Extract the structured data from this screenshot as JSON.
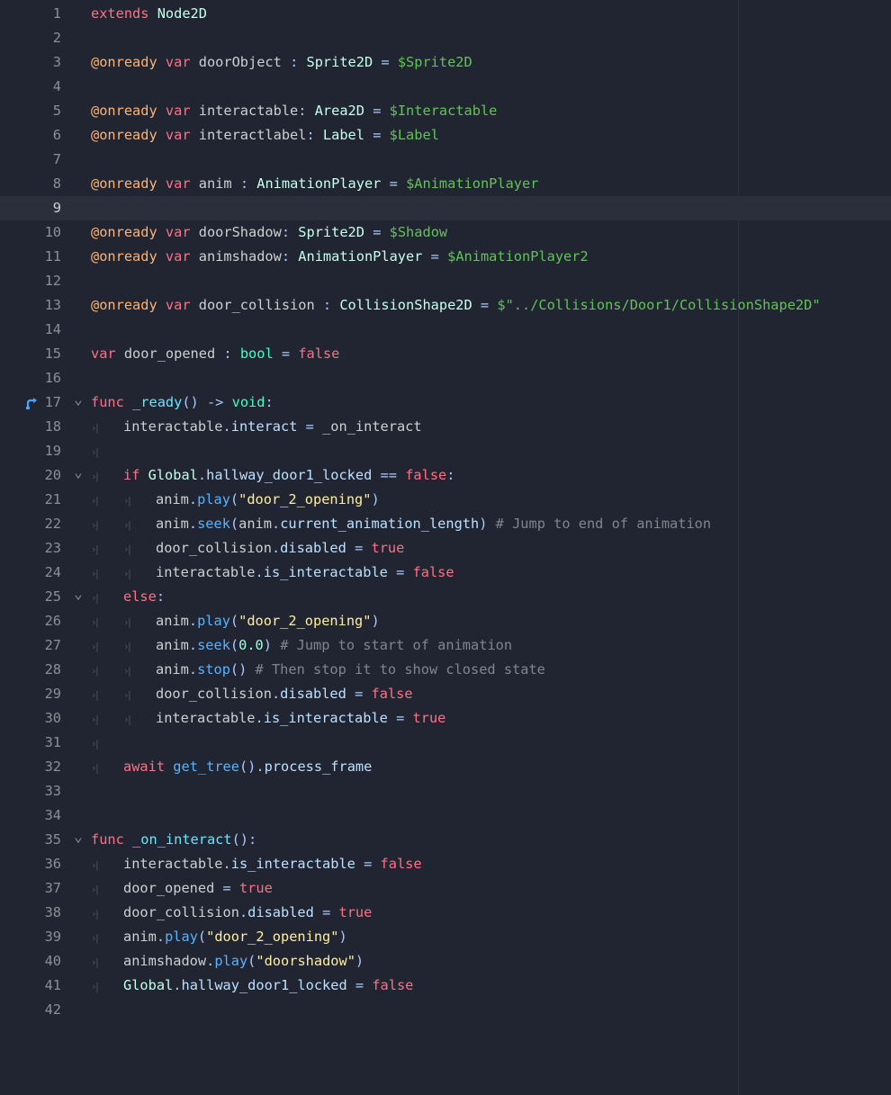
{
  "editor": {
    "current_line": 9,
    "lines": [
      {
        "n": "1",
        "fold": false,
        "indent": 0,
        "tokens": [
          {
            "t": "extends",
            "c": "k"
          },
          {
            "t": " "
          },
          {
            "t": "Node2D",
            "c": "tc"
          }
        ]
      },
      {
        "n": "2",
        "fold": false,
        "indent": 0,
        "tokens": []
      },
      {
        "n": "3",
        "fold": false,
        "indent": 0,
        "tokens": [
          {
            "t": "@onready",
            "c": "a"
          },
          {
            "t": " "
          },
          {
            "t": "var",
            "c": "k"
          },
          {
            "t": " doorObject "
          },
          {
            "t": ":",
            "c": "p"
          },
          {
            "t": " "
          },
          {
            "t": "Sprite2D",
            "c": "tc"
          },
          {
            "t": " "
          },
          {
            "t": "=",
            "c": "p"
          },
          {
            "t": " "
          },
          {
            "t": "$Sprite2D",
            "c": "np"
          }
        ]
      },
      {
        "n": "4",
        "fold": false,
        "indent": 0,
        "tokens": []
      },
      {
        "n": "5",
        "fold": false,
        "indent": 0,
        "tokens": [
          {
            "t": "@onready",
            "c": "a"
          },
          {
            "t": " "
          },
          {
            "t": "var",
            "c": "k"
          },
          {
            "t": " interactable"
          },
          {
            "t": ":",
            "c": "p"
          },
          {
            "t": " "
          },
          {
            "t": "Area2D",
            "c": "tc"
          },
          {
            "t": " "
          },
          {
            "t": "=",
            "c": "p"
          },
          {
            "t": " "
          },
          {
            "t": "$Interactable",
            "c": "np"
          }
        ]
      },
      {
        "n": "6",
        "fold": false,
        "indent": 0,
        "tokens": [
          {
            "t": "@onready",
            "c": "a"
          },
          {
            "t": " "
          },
          {
            "t": "var",
            "c": "k"
          },
          {
            "t": " interactlabel"
          },
          {
            "t": ":",
            "c": "p"
          },
          {
            "t": " "
          },
          {
            "t": "Label",
            "c": "tc"
          },
          {
            "t": " "
          },
          {
            "t": "=",
            "c": "p"
          },
          {
            "t": " "
          },
          {
            "t": "$Label",
            "c": "np"
          }
        ]
      },
      {
        "n": "7",
        "fold": false,
        "indent": 0,
        "tokens": []
      },
      {
        "n": "8",
        "fold": false,
        "indent": 0,
        "tokens": [
          {
            "t": "@onready",
            "c": "a"
          },
          {
            "t": " "
          },
          {
            "t": "var",
            "c": "k"
          },
          {
            "t": " anim "
          },
          {
            "t": ":",
            "c": "p"
          },
          {
            "t": " "
          },
          {
            "t": "AnimationPlayer",
            "c": "tc"
          },
          {
            "t": " "
          },
          {
            "t": "=",
            "c": "p"
          },
          {
            "t": " "
          },
          {
            "t": "$AnimationPlayer",
            "c": "np"
          }
        ]
      },
      {
        "n": "9",
        "fold": false,
        "indent": 0,
        "tokens": []
      },
      {
        "n": "10",
        "fold": false,
        "indent": 0,
        "tokens": [
          {
            "t": "@onready",
            "c": "a"
          },
          {
            "t": " "
          },
          {
            "t": "var",
            "c": "k"
          },
          {
            "t": " doorShadow"
          },
          {
            "t": ":",
            "c": "p"
          },
          {
            "t": " "
          },
          {
            "t": "Sprite2D",
            "c": "tc"
          },
          {
            "t": " "
          },
          {
            "t": "=",
            "c": "p"
          },
          {
            "t": " "
          },
          {
            "t": "$Shadow",
            "c": "np"
          }
        ]
      },
      {
        "n": "11",
        "fold": false,
        "indent": 0,
        "tokens": [
          {
            "t": "@onready",
            "c": "a"
          },
          {
            "t": " "
          },
          {
            "t": "var",
            "c": "k"
          },
          {
            "t": " animshadow"
          },
          {
            "t": ":",
            "c": "p"
          },
          {
            "t": " "
          },
          {
            "t": "AnimationPlayer",
            "c": "tc"
          },
          {
            "t": " "
          },
          {
            "t": "=",
            "c": "p"
          },
          {
            "t": " "
          },
          {
            "t": "$AnimationPlayer2",
            "c": "np"
          }
        ]
      },
      {
        "n": "12",
        "fold": false,
        "indent": 0,
        "tokens": []
      },
      {
        "n": "13",
        "fold": false,
        "indent": 0,
        "tokens": [
          {
            "t": "@onready",
            "c": "a"
          },
          {
            "t": " "
          },
          {
            "t": "var",
            "c": "k"
          },
          {
            "t": " door_collision "
          },
          {
            "t": ":",
            "c": "p"
          },
          {
            "t": " "
          },
          {
            "t": "CollisionShape2D",
            "c": "tc"
          },
          {
            "t": " "
          },
          {
            "t": "=",
            "c": "p"
          },
          {
            "t": " "
          },
          {
            "t": "$\"../Collisions/Door1/CollisionShape2D\"",
            "c": "np"
          }
        ]
      },
      {
        "n": "14",
        "fold": false,
        "indent": 0,
        "tokens": []
      },
      {
        "n": "15",
        "fold": false,
        "indent": 0,
        "tokens": [
          {
            "t": "var",
            "c": "k"
          },
          {
            "t": " door_opened "
          },
          {
            "t": ":",
            "c": "p"
          },
          {
            "t": " "
          },
          {
            "t": "bool",
            "c": "t"
          },
          {
            "t": " "
          },
          {
            "t": "=",
            "c": "p"
          },
          {
            "t": " "
          },
          {
            "t": "false",
            "c": "k"
          }
        ]
      },
      {
        "n": "16",
        "fold": false,
        "indent": 0,
        "tokens": []
      },
      {
        "n": "17",
        "fold": true,
        "override_icon": true,
        "indent": 0,
        "tokens": [
          {
            "t": "func",
            "c": "k"
          },
          {
            "t": " "
          },
          {
            "t": "_ready",
            "c": "fd"
          },
          {
            "t": "()",
            "c": "p"
          },
          {
            "t": " "
          },
          {
            "t": "->",
            "c": "p"
          },
          {
            "t": " "
          },
          {
            "t": "void",
            "c": "t"
          },
          {
            "t": ":",
            "c": "p"
          }
        ]
      },
      {
        "n": "18",
        "fold": false,
        "indent": 1,
        "tokens": [
          {
            "t": "interactable"
          },
          {
            "t": ".",
            "c": "p"
          },
          {
            "t": "interact",
            "c": "m"
          },
          {
            "t": " "
          },
          {
            "t": "=",
            "c": "p"
          },
          {
            "t": " _on_interact"
          }
        ]
      },
      {
        "n": "19",
        "fold": false,
        "indent": 1,
        "tokens": []
      },
      {
        "n": "20",
        "fold": true,
        "indent": 1,
        "tokens": [
          {
            "t": "if",
            "c": "k"
          },
          {
            "t": " "
          },
          {
            "t": "Global",
            "c": "tc"
          },
          {
            "t": ".",
            "c": "p"
          },
          {
            "t": "hallway_door1_locked",
            "c": "m"
          },
          {
            "t": " "
          },
          {
            "t": "==",
            "c": "p"
          },
          {
            "t": " "
          },
          {
            "t": "false",
            "c": "k"
          },
          {
            "t": ":",
            "c": "p"
          }
        ]
      },
      {
        "n": "21",
        "fold": false,
        "indent": 2,
        "tokens": [
          {
            "t": "anim"
          },
          {
            "t": ".",
            "c": "p"
          },
          {
            "t": "play",
            "c": "f"
          },
          {
            "t": "(",
            "c": "p"
          },
          {
            "t": "\"door_2_opening\"",
            "c": "s"
          },
          {
            "t": ")",
            "c": "p"
          }
        ]
      },
      {
        "n": "22",
        "fold": false,
        "indent": 2,
        "tokens": [
          {
            "t": "anim"
          },
          {
            "t": ".",
            "c": "p"
          },
          {
            "t": "seek",
            "c": "f"
          },
          {
            "t": "(",
            "c": "p"
          },
          {
            "t": "anim"
          },
          {
            "t": ".",
            "c": "p"
          },
          {
            "t": "current_animation_length",
            "c": "m"
          },
          {
            "t": ")",
            "c": "p"
          },
          {
            "t": " "
          },
          {
            "t": "# Jump to end of animation",
            "c": "c"
          }
        ]
      },
      {
        "n": "23",
        "fold": false,
        "indent": 2,
        "tokens": [
          {
            "t": "door_collision"
          },
          {
            "t": ".",
            "c": "p"
          },
          {
            "t": "disabled",
            "c": "m"
          },
          {
            "t": " "
          },
          {
            "t": "=",
            "c": "p"
          },
          {
            "t": " "
          },
          {
            "t": "true",
            "c": "k"
          }
        ]
      },
      {
        "n": "24",
        "fold": false,
        "indent": 2,
        "tokens": [
          {
            "t": "interactable"
          },
          {
            "t": ".",
            "c": "p"
          },
          {
            "t": "is_interactable",
            "c": "m"
          },
          {
            "t": " "
          },
          {
            "t": "=",
            "c": "p"
          },
          {
            "t": " "
          },
          {
            "t": "false",
            "c": "k"
          }
        ]
      },
      {
        "n": "25",
        "fold": true,
        "indent": 1,
        "tokens": [
          {
            "t": "else",
            "c": "k"
          },
          {
            "t": ":",
            "c": "p"
          }
        ]
      },
      {
        "n": "26",
        "fold": false,
        "indent": 2,
        "tokens": [
          {
            "t": "anim"
          },
          {
            "t": ".",
            "c": "p"
          },
          {
            "t": "play",
            "c": "f"
          },
          {
            "t": "(",
            "c": "p"
          },
          {
            "t": "\"door_2_opening\"",
            "c": "s"
          },
          {
            "t": ")",
            "c": "p"
          }
        ]
      },
      {
        "n": "27",
        "fold": false,
        "indent": 2,
        "tokens": [
          {
            "t": "anim"
          },
          {
            "t": ".",
            "c": "p"
          },
          {
            "t": "seek",
            "c": "f"
          },
          {
            "t": "(",
            "c": "p"
          },
          {
            "t": "0.0",
            "c": "n"
          },
          {
            "t": ")",
            "c": "p"
          },
          {
            "t": " "
          },
          {
            "t": "# Jump to start of animation",
            "c": "c"
          }
        ]
      },
      {
        "n": "28",
        "fold": false,
        "indent": 2,
        "tokens": [
          {
            "t": "anim"
          },
          {
            "t": ".",
            "c": "p"
          },
          {
            "t": "stop",
            "c": "f"
          },
          {
            "t": "()",
            "c": "p"
          },
          {
            "t": " "
          },
          {
            "t": "# Then stop it to show closed state",
            "c": "c"
          }
        ]
      },
      {
        "n": "29",
        "fold": false,
        "indent": 2,
        "tokens": [
          {
            "t": "door_collision"
          },
          {
            "t": ".",
            "c": "p"
          },
          {
            "t": "disabled",
            "c": "m"
          },
          {
            "t": " "
          },
          {
            "t": "=",
            "c": "p"
          },
          {
            "t": " "
          },
          {
            "t": "false",
            "c": "k"
          }
        ]
      },
      {
        "n": "30",
        "fold": false,
        "indent": 2,
        "tokens": [
          {
            "t": "interactable"
          },
          {
            "t": ".",
            "c": "p"
          },
          {
            "t": "is_interactable",
            "c": "m"
          },
          {
            "t": " "
          },
          {
            "t": "=",
            "c": "p"
          },
          {
            "t": " "
          },
          {
            "t": "true",
            "c": "k"
          }
        ]
      },
      {
        "n": "31",
        "fold": false,
        "indent": 1,
        "tokens": []
      },
      {
        "n": "32",
        "fold": false,
        "indent": 1,
        "tokens": [
          {
            "t": "await",
            "c": "k"
          },
          {
            "t": " "
          },
          {
            "t": "get_tree",
            "c": "f"
          },
          {
            "t": "()",
            "c": "p"
          },
          {
            "t": ".",
            "c": "p"
          },
          {
            "t": "process_frame",
            "c": "m"
          }
        ]
      },
      {
        "n": "33",
        "fold": false,
        "indent": 0,
        "tokens": []
      },
      {
        "n": "34",
        "fold": false,
        "indent": 0,
        "tokens": []
      },
      {
        "n": "35",
        "fold": true,
        "indent": 0,
        "tokens": [
          {
            "t": "func",
            "c": "k"
          },
          {
            "t": " "
          },
          {
            "t": "_on_interact",
            "c": "fd"
          },
          {
            "t": "():",
            "c": "p"
          }
        ]
      },
      {
        "n": "36",
        "fold": false,
        "indent": 1,
        "tokens": [
          {
            "t": "interactable"
          },
          {
            "t": ".",
            "c": "p"
          },
          {
            "t": "is_interactable",
            "c": "m"
          },
          {
            "t": " "
          },
          {
            "t": "=",
            "c": "p"
          },
          {
            "t": " "
          },
          {
            "t": "false",
            "c": "k"
          }
        ]
      },
      {
        "n": "37",
        "fold": false,
        "indent": 1,
        "tokens": [
          {
            "t": "door_opened"
          },
          {
            "t": " "
          },
          {
            "t": "=",
            "c": "p"
          },
          {
            "t": " "
          },
          {
            "t": "true",
            "c": "k"
          }
        ]
      },
      {
        "n": "38",
        "fold": false,
        "indent": 1,
        "tokens": [
          {
            "t": "door_collision"
          },
          {
            "t": ".",
            "c": "p"
          },
          {
            "t": "disabled",
            "c": "m"
          },
          {
            "t": " "
          },
          {
            "t": "=",
            "c": "p"
          },
          {
            "t": " "
          },
          {
            "t": "true",
            "c": "k"
          }
        ]
      },
      {
        "n": "39",
        "fold": false,
        "indent": 1,
        "tokens": [
          {
            "t": "anim"
          },
          {
            "t": ".",
            "c": "p"
          },
          {
            "t": "play",
            "c": "f"
          },
          {
            "t": "(",
            "c": "p"
          },
          {
            "t": "\"door_2_opening\"",
            "c": "s"
          },
          {
            "t": ")",
            "c": "p"
          }
        ]
      },
      {
        "n": "40",
        "fold": false,
        "indent": 1,
        "tokens": [
          {
            "t": "animshadow"
          },
          {
            "t": ".",
            "c": "p"
          },
          {
            "t": "play",
            "c": "f"
          },
          {
            "t": "(",
            "c": "p"
          },
          {
            "t": "\"doorshadow\"",
            "c": "s"
          },
          {
            "t": ")",
            "c": "p"
          }
        ]
      },
      {
        "n": "41",
        "fold": false,
        "indent": 1,
        "tokens": [
          {
            "t": "Global",
            "c": "tc"
          },
          {
            "t": ".",
            "c": "p"
          },
          {
            "t": "hallway_door1_locked",
            "c": "m"
          },
          {
            "t": " "
          },
          {
            "t": "=",
            "c": "p"
          },
          {
            "t": " "
          },
          {
            "t": "false",
            "c": "k"
          }
        ]
      },
      {
        "n": "42",
        "fold": false,
        "indent": 0,
        "tokens": []
      }
    ],
    "icons": {
      "fold": "chevron-down-icon",
      "tab": "tab-arrow-icon",
      "override": "override-method-icon"
    },
    "colors": {
      "background": "#202531",
      "current_line": "#2a2f3b",
      "keyword": "#ff7085",
      "annotation": "#ffb373",
      "engine_type": "#c7ffed",
      "node_path": "#63c259",
      "string": "#ffeda1",
      "function_call": "#57b3ff",
      "comment": "#81858d"
    }
  }
}
